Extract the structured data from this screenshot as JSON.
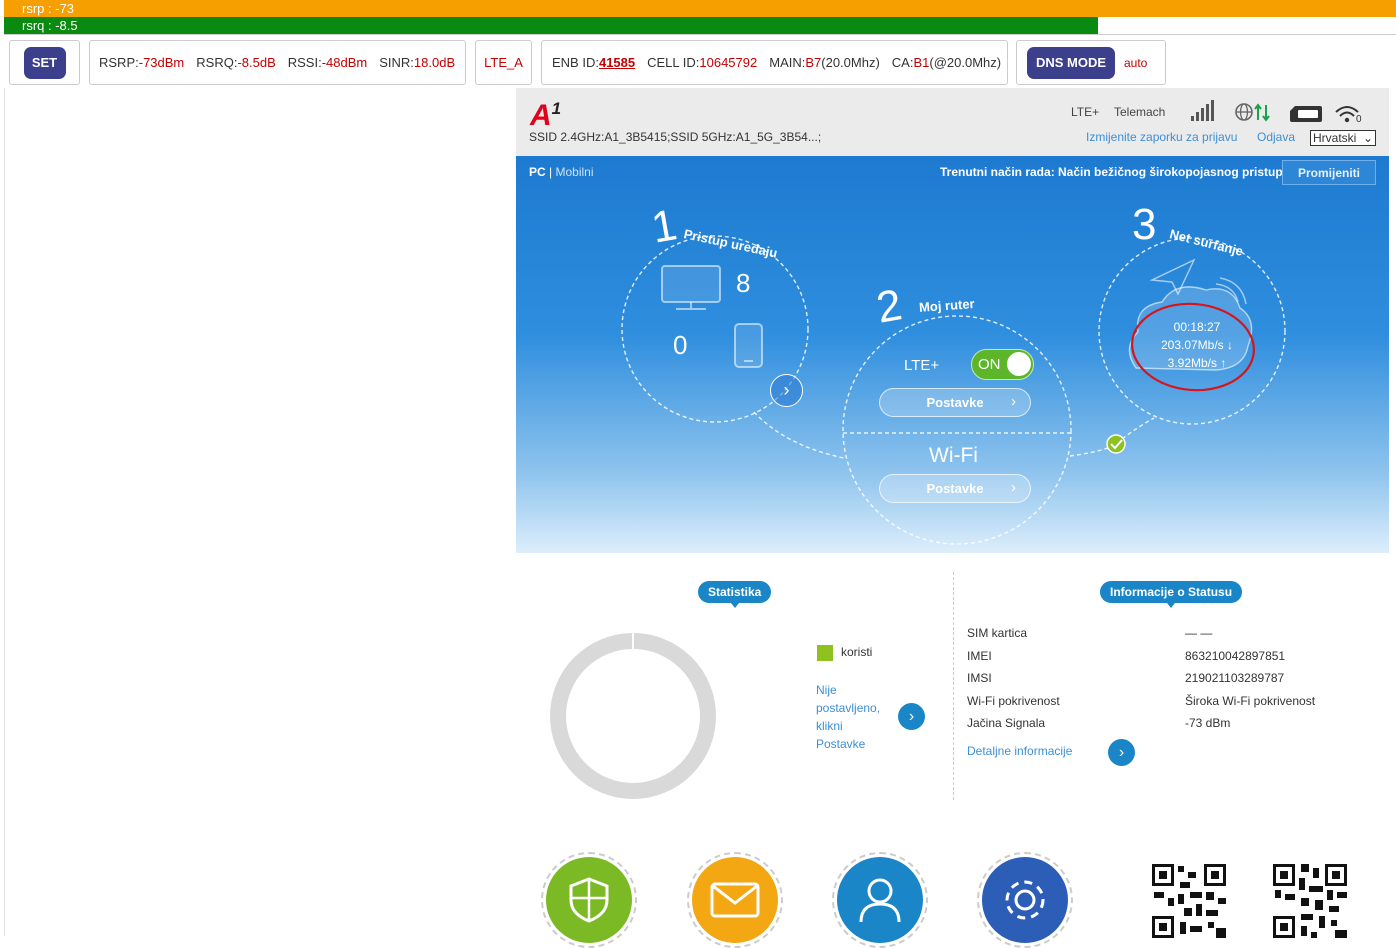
{
  "signal_bars": {
    "rsrp": "rsrp : -73",
    "rsrq": "rsrq : -8.5"
  },
  "toolbar": {
    "set_label": "SET",
    "rsrp_label": "RSRP:",
    "rsrp_value": "-73dBm",
    "rsrq_label": "RSRQ:",
    "rsrq_value": "-8.5dB",
    "rssi_label": "RSSI:",
    "rssi_value": "-48dBm",
    "sinr_label": "SINR:",
    "sinr_value": "18.0dB",
    "mode": "LTE_A",
    "enb_label": "ENB ID:",
    "enb_value": "41585",
    "cell_label": "CELL ID:",
    "cell_value": "10645792",
    "main_label": "MAIN:",
    "main_value": "B7",
    "main_bw": "(20.0Mhz)",
    "ca_label": "CA:",
    "ca_value": "B1",
    "ca_bw": "(@20.0Mhz)",
    "dns_label": "DNS MODE",
    "dns_value": "auto"
  },
  "header": {
    "logo_letter": "A",
    "logo_sup": "1",
    "ssid": "SSID 2.4GHz:A1_3B5415;SSID 5GHz:A1_5G_3B54...;",
    "network_type": "LTE+",
    "operator": "Telemach",
    "change_password": "Izmijenite zaporku za prijavu",
    "logout": "Odjava",
    "language": "Hrvatski",
    "wifi_count": "0"
  },
  "main": {
    "view_pc": "PC",
    "view_sep": " | ",
    "view_mobile": "Mobilni",
    "mode_text": "Trenutni način rada: Način bežičnog širokopojasnog pristupa",
    "change_btn": "Promijeniti",
    "step1_num": "1",
    "step1_title": "Pristup uređaju",
    "pc_count": "8",
    "mobile_count": "0",
    "step2_num": "2",
    "step2_title": "Moj ruter",
    "lte_label": "LTE+",
    "toggle_label": "ON",
    "settings_label": "Postavke",
    "wifi_label": "Wi-Fi",
    "step3_num": "3",
    "step3_title": "Net surfanje",
    "uptime": "00:18:27",
    "download": "203.07Mb/s ↓",
    "upload": "3.92Mb/s ↑"
  },
  "stats": {
    "badge": "Statistika",
    "legend": "koristi",
    "not_set_lines": [
      "Nije",
      "postavljeno,",
      "klikni",
      "Postavke"
    ]
  },
  "status": {
    "badge": "Informacije o Statusu",
    "rows": [
      {
        "label": "SIM kartica",
        "value": "— —"
      },
      {
        "label": "IMEI",
        "value": "863210042897851"
      },
      {
        "label": "IMSI",
        "value": "219021103289787"
      },
      {
        "label": "Wi-Fi pokrivenost",
        "value": "Široka Wi-Fi pokrivenost"
      },
      {
        "label": "Jačina Signala",
        "value": "-73 dBm"
      }
    ],
    "details": "Detaljne informacije"
  },
  "colors": {
    "accent": "#1a86c8",
    "toolbar_btn": "#3b3f8c",
    "rsrp_bar": "#f5a000",
    "rsrq_bar": "#0a8a10",
    "used": "#8dc21f"
  }
}
